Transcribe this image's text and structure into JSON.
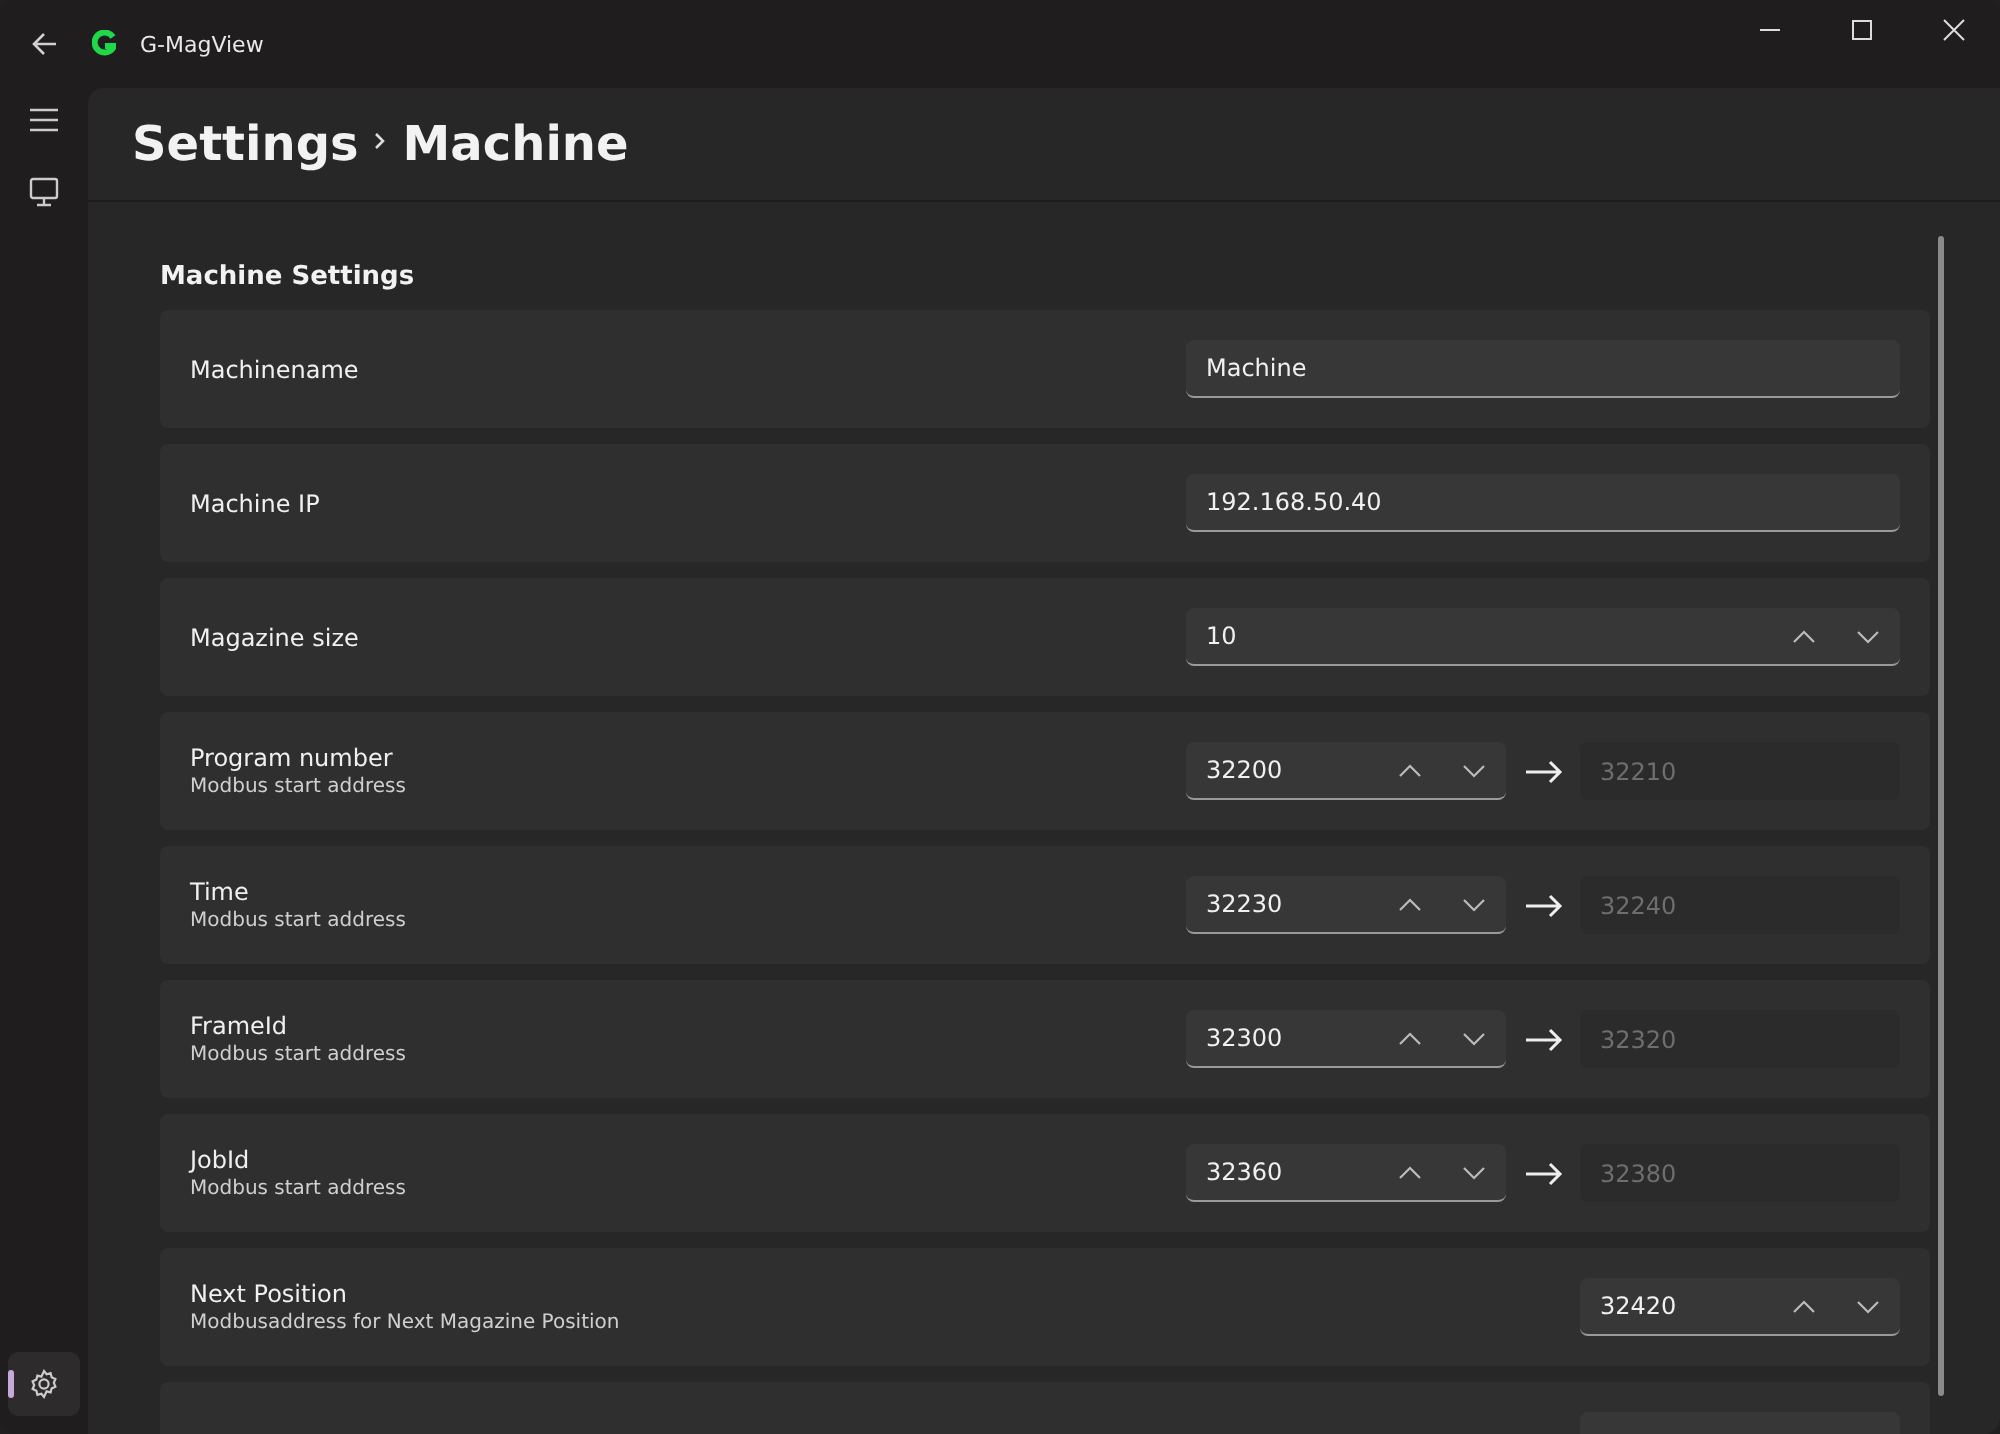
{
  "window": {
    "title": "G-MagView"
  },
  "nav": {
    "items": [
      {
        "selected": false
      },
      {
        "selected": true
      }
    ]
  },
  "breadcrumb": [
    "Settings",
    "Machine"
  ],
  "section_title": "Machine Settings",
  "rows": [
    {
      "kind": "text",
      "label": "Machinename",
      "value": "Machine"
    },
    {
      "kind": "text",
      "label": "Machine IP",
      "value": "192.168.50.40"
    },
    {
      "kind": "number",
      "label": "Magazine size",
      "value": "10"
    },
    {
      "kind": "range",
      "label": "Program number",
      "description": "Modbus start address",
      "value": "32200",
      "end": "32210"
    },
    {
      "kind": "range",
      "label": "Time",
      "description": "Modbus start address",
      "value": "32230",
      "end": "32240"
    },
    {
      "kind": "range",
      "label": "FrameId",
      "description": "Modbus start address",
      "value": "32300",
      "end": "32320"
    },
    {
      "kind": "range",
      "label": "JobId",
      "description": "Modbus start address",
      "value": "32360",
      "end": "32380"
    },
    {
      "kind": "short-number",
      "label": "Next Position",
      "description": "Modbusaddress for Next Magazine Position",
      "value": "32420"
    },
    {
      "kind": "short-number"
    }
  ]
}
